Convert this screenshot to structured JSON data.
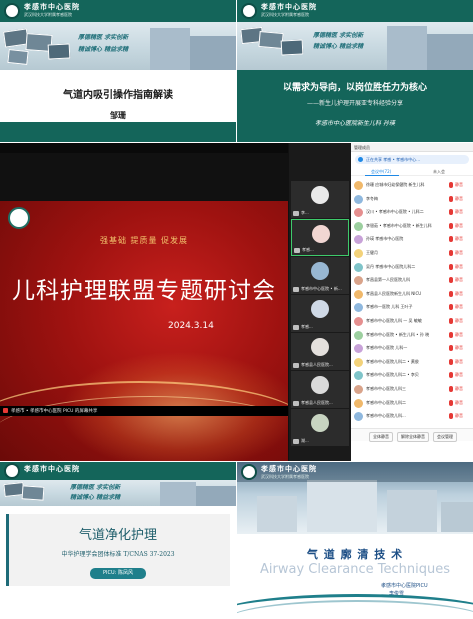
{
  "common": {
    "hospital_name": "孝感市中心医院",
    "hospital_sub": "武汉科技大学附属孝感医院",
    "slogan_top": "厚德精医  求实创新",
    "slogan_bottom": "精诚博心  精益求精"
  },
  "panel1": {
    "title": "气道内吸引操作指南解读",
    "presenter": "邹珊"
  },
  "panel2": {
    "title": "以需求为导向，以岗位胜任力为核心",
    "subtitle": "——新生儿护理开展亚专科经验分享",
    "speaker": "孝感市中心医院新生儿科  孙瑛"
  },
  "panel3": {
    "slide": {
      "slogan": "强基础  提质量  促发展",
      "title": "儿科护理联盟专题研讨会",
      "date": "2024.3.14"
    },
    "share_status": "孝感市 • 孝感市中心医院 PICU 的屏幕共享",
    "thumbnails": [
      "李...",
      "孝感...",
      "",
      "孝感市中心医院 • 新...",
      "孝感...",
      "孝感县人民医院...",
      "孝感县人民医院...",
      "湖...",
      "孝感...",
      "孝感..."
    ],
    "member_panel": {
      "title": "管理成员",
      "meeting_tag": "正在共享  孝感 • 孝感市中心...",
      "tabs": [
        "会议中(72)",
        "未入会"
      ],
      "members": [
        {
          "name": "徐珊 应城市妇幼保健院 新生儿科",
          "tag": "静音"
        },
        {
          "name": "李冬梅",
          "tag": "静音"
        },
        {
          "name": "汉川 • 孝感市中心医院 • 儿科二",
          "tag": "静音"
        },
        {
          "name": "李银茹 • 孝感市中心医院 • 新生儿科",
          "tag": "静音"
        },
        {
          "name": "孙瑛 孝感市中心医院",
          "tag": "静音"
        },
        {
          "name": "王健月",
          "tag": "静音"
        },
        {
          "name": "吴丹 孝感市中心医院儿科二",
          "tag": "静音"
        },
        {
          "name": "孝昌县第一人民医院儿科",
          "tag": "静音"
        },
        {
          "name": "孝昌县人民医院新生儿科 NICU",
          "tag": "静音"
        },
        {
          "name": "孝感市一医院 儿科 王叶子",
          "tag": "静音"
        },
        {
          "name": "孝感市中心医院儿科 — 吴 敏敏",
          "tag": "静音"
        },
        {
          "name": "孝感市中心医院 • 新生儿科 • 孙 晓",
          "tag": "静音"
        },
        {
          "name": "孝感市中心医院 儿科一",
          "tag": "静音"
        },
        {
          "name": "孝感市中心医院儿科二 • 黄俊",
          "tag": "静音"
        },
        {
          "name": "孝感市中心医院儿科二 • 李贝",
          "tag": "静音"
        },
        {
          "name": "孝感市中心医院儿科三",
          "tag": "静音"
        },
        {
          "name": "孝感市中心医院儿科二",
          "tag": "静音"
        },
        {
          "name": "孝感市中心医院儿科...",
          "tag": "静音"
        }
      ],
      "footer_buttons": [
        "全体静音",
        "解除全体静音",
        "会议管理"
      ]
    }
  },
  "panel4": {
    "title": "气道净化护理",
    "subtitle": "中华护理学会团体标准  T/CNAS 37-2023",
    "badge": "PICU: 陈凤风"
  },
  "panel5": {
    "title_cn": "气 道 廓 清 技 术",
    "title_en": "Airway Clearance Techniques",
    "presenter_line1": "孝感市中心医院PICU",
    "presenter_line2": "李俊雪"
  },
  "colors": {
    "header_green": "#14655a",
    "slide_red": "#b3161a",
    "gold": "#f2c46d"
  }
}
